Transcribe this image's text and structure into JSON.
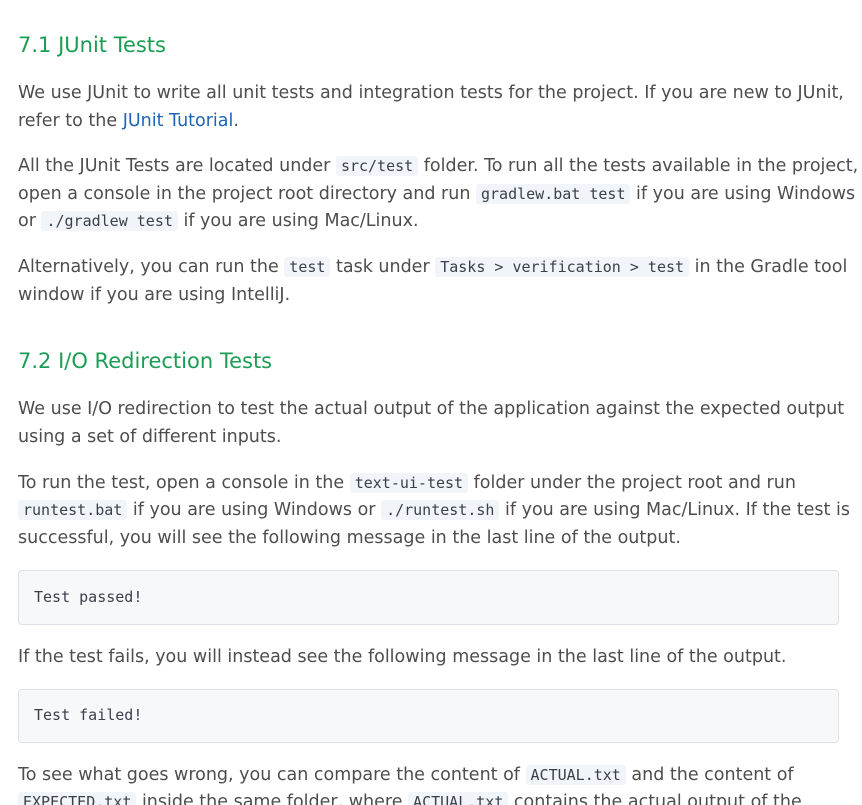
{
  "junit": {
    "heading": "7.1 JUnit Tests",
    "p1": {
      "l1": "We use JUnit to write all unit tests and integration tests for the project. If you are new to JUnit,",
      "l2_a": "refer to the ",
      "l2_link": "JUnit Tutorial",
      "l2_b": "."
    },
    "p2": {
      "l1_a": "All the JUnit Tests are located under ",
      "l1_code": "src/test",
      "l1_b": " folder. To run all the tests available in the project,",
      "l2_a": "open a console in the project root directory and run ",
      "l2_code": "gradlew.bat test",
      "l2_b": " if you are using Windows",
      "l3_a": "or ",
      "l3_code": "./gradlew test",
      "l3_b": " if you are using Mac/Linux."
    },
    "p3": {
      "l1_a": "Alternatively, you can run the ",
      "l1_code1": "test",
      "l1_b": " task under ",
      "l1_code2": "Tasks > verification > test",
      "l1_c": " in the Gradle tool",
      "l2": "window if you are using IntelliJ."
    }
  },
  "io": {
    "heading": "7.2 I/O Redirection Tests",
    "p1": {
      "l1": "We use I/O redirection to test the actual output of the application against the expected output",
      "l2": "using a set of different inputs."
    },
    "p2": {
      "l1_a": "To run the test, open a console in the ",
      "l1_code": "text-ui-test",
      "l1_b": " folder under the project root and run",
      "l2_code1": "runtest.bat",
      "l2_a": " if you are using Windows or ",
      "l2_code2": "./runtest.sh",
      "l2_b": " if you are using Mac/Linux. If the test is",
      "l3": "successful, you will see the following message in the last line of the output."
    },
    "code_passed": "Test passed!",
    "p3": "If the test fails, you will instead see the following message in the last line of the output.",
    "code_failed": "Test failed!",
    "p4": {
      "l1_a": "To see what goes wrong, you can compare the content of ",
      "l1_code": "ACTUAL.txt",
      "l1_b": " and the content of",
      "l2_code1": "EXPECTED.txt",
      "l2_a": " inside the same folder, where ",
      "l2_code2": "ACTUAL.txt",
      "l2_b": " contains the actual output of the"
    }
  }
}
